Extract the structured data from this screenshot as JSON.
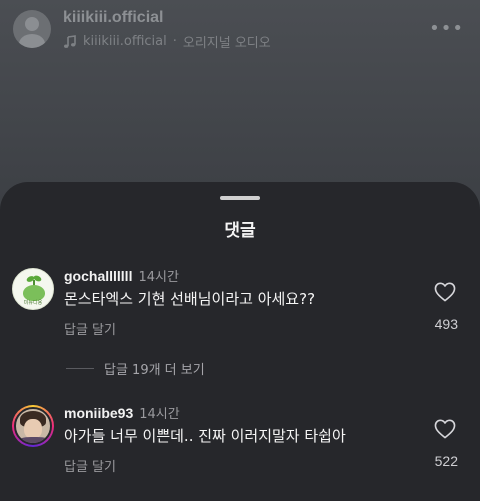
{
  "reel": {
    "username": "kiiikiii.official",
    "audio_account": "kiiikiii.official",
    "audio_separator": "·",
    "audio_label": "오리지널 오디오",
    "more_icon": "more-horizontal-icon"
  },
  "comments_sheet": {
    "title": "댓글",
    "comments": [
      {
        "username": "gochalllllll",
        "time": "14시간",
        "text": "몬스타엑스 기현 선배님이라고 아세요??",
        "reply_label": "답글 달기",
        "likes": "493",
        "avatar_caption": "미뉴디용"
      },
      {
        "username": "moniibe93",
        "time": "14시간",
        "text": "아가들 너무 이쁜데.. 진짜 이러지말자 타쉽아",
        "reply_label": "답글 달기",
        "likes": "522"
      }
    ],
    "view_more_replies": "답글 19개 더 보기"
  },
  "colors": {
    "sheet_bg": "#26272b",
    "text_primary": "#f5f5f5",
    "text_secondary": "#9a9a9e"
  }
}
